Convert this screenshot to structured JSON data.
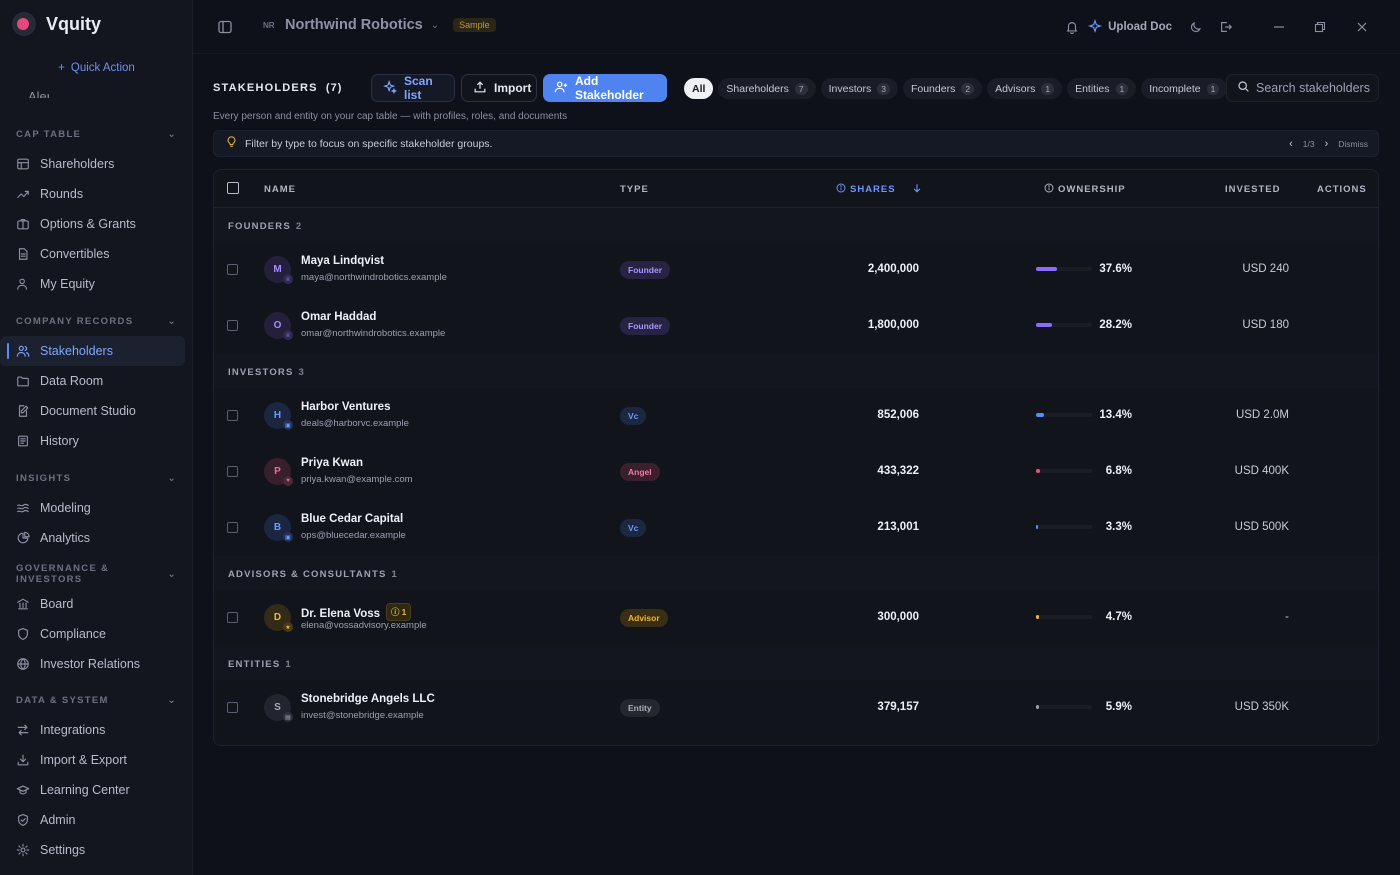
{
  "app": {
    "name": "Vquity",
    "quick_action": "Quick Action",
    "alerts_label": "Alerts"
  },
  "sidebar": {
    "sections": [
      {
        "title": "CAP TABLE",
        "items": [
          {
            "label": "Shareholders",
            "icon": "table-icon"
          },
          {
            "label": "Rounds",
            "icon": "trend-icon"
          },
          {
            "label": "Options & Grants",
            "icon": "briefcase-icon"
          },
          {
            "label": "Convertibles",
            "icon": "document-icon"
          },
          {
            "label": "My Equity",
            "icon": "user-icon"
          }
        ]
      },
      {
        "title": "COMPANY RECORDS",
        "items": [
          {
            "label": "Stakeholders",
            "icon": "users-icon",
            "active": true
          },
          {
            "label": "Data Room",
            "icon": "folder-icon"
          },
          {
            "label": "Document Studio",
            "icon": "edit-document-icon"
          },
          {
            "label": "History",
            "icon": "history-icon"
          }
        ]
      },
      {
        "title": "INSIGHTS",
        "items": [
          {
            "label": "Modeling",
            "icon": "waves-icon"
          },
          {
            "label": "Analytics",
            "icon": "pie-icon"
          }
        ]
      },
      {
        "title": "GOVERNANCE & INVESTORS",
        "items": [
          {
            "label": "Board",
            "icon": "building-icon"
          },
          {
            "label": "Compliance",
            "icon": "shield-icon"
          },
          {
            "label": "Investor Relations",
            "icon": "globe-icon"
          }
        ]
      },
      {
        "title": "DATA & SYSTEM",
        "items": [
          {
            "label": "Integrations",
            "icon": "arrows-icon"
          },
          {
            "label": "Import & Export",
            "icon": "download-icon"
          },
          {
            "label": "Learning Center",
            "icon": "graduation-icon"
          },
          {
            "label": "Admin",
            "icon": "shield-check-icon"
          },
          {
            "label": "Settings",
            "icon": "gear-icon"
          }
        ]
      }
    ]
  },
  "topbar": {
    "org_initials": "NR",
    "org_name": "Northwind Robotics",
    "sample_badge": "Sample",
    "upload_doc": "Upload Doc"
  },
  "page": {
    "title": "STAKEHOLDERS",
    "count": "(7)",
    "scan_list": "Scan list",
    "import": "Import",
    "add_stakeholder": "Add Stakeholder",
    "subtitle": "Every person and entity on your cap table — with profiles, roles, and documents",
    "search_placeholder": "Search stakeholders",
    "tip": "Filter by type to focus on specific stakeholder groups.",
    "tip_page": "1/3",
    "dismiss": "Dismiss"
  },
  "filters": [
    {
      "label": "All",
      "active": true
    },
    {
      "label": "Shareholders",
      "count": "7"
    },
    {
      "label": "Investors",
      "count": "3"
    },
    {
      "label": "Founders",
      "count": "2"
    },
    {
      "label": "Advisors",
      "count": "1"
    },
    {
      "label": "Entities",
      "count": "1"
    },
    {
      "label": "Incomplete",
      "count": "1"
    }
  ],
  "table": {
    "headers": {
      "name": "NAME",
      "type": "TYPE",
      "shares": "SHARES",
      "ownership": "OWNERSHIP",
      "invested": "INVESTED",
      "actions": "ACTIONS"
    },
    "groups": [
      {
        "label": "FOUNDERS",
        "count": "2",
        "rows": [
          {
            "initial": "M",
            "name": "Maya Lindqvist",
            "email": "maya@northwindrobotics.example",
            "type": "Founder",
            "shares": "2,400,000",
            "ownership": "37.6%",
            "ownership_value": 0.376,
            "invested": "USD 240",
            "color": "purple"
          },
          {
            "initial": "O",
            "name": "Omar Haddad",
            "email": "omar@northwindrobotics.example",
            "type": "Founder",
            "shares": "1,800,000",
            "ownership": "28.2%",
            "ownership_value": 0.282,
            "invested": "USD 180",
            "color": "purple"
          }
        ]
      },
      {
        "label": "INVESTORS",
        "count": "3",
        "rows": [
          {
            "initial": "H",
            "name": "Harbor Ventures",
            "email": "deals@harborvc.example",
            "type": "Vc",
            "shares": "852,006",
            "ownership": "13.4%",
            "ownership_value": 0.134,
            "invested": "USD 2.0M",
            "color": "blue"
          },
          {
            "initial": "P",
            "name": "Priya Kwan",
            "email": "priya.kwan@example.com",
            "type": "Angel",
            "shares": "433,322",
            "ownership": "6.8%",
            "ownership_value": 0.068,
            "invested": "USD 400K",
            "color": "pink"
          },
          {
            "initial": "B",
            "name": "Blue Cedar Capital",
            "email": "ops@bluecedar.example",
            "type": "Vc",
            "shares": "213,001",
            "ownership": "3.3%",
            "ownership_value": 0.033,
            "invested": "USD 500K",
            "color": "blue"
          }
        ]
      },
      {
        "label": "ADVISORS & CONSULTANTS",
        "count": "1",
        "rows": [
          {
            "initial": "D",
            "name": "Dr. Elena Voss",
            "email": "elena@vossadvisory.example",
            "type": "Advisor",
            "shares": "300,000",
            "ownership": "4.7%",
            "ownership_value": 0.047,
            "invested": "-",
            "color": "amber",
            "warning": "1"
          }
        ]
      },
      {
        "label": "ENTITIES",
        "count": "1",
        "rows": [
          {
            "initial": "S",
            "name": "Stonebridge Angels LLC",
            "email": "invest@stonebridge.example",
            "type": "Entity",
            "shares": "379,157",
            "ownership": "5.9%",
            "ownership_value": 0.059,
            "invested": "USD 350K",
            "color": "grey"
          }
        ]
      }
    ]
  },
  "colors": {
    "accent": "#4e83f0",
    "purple": "#8b6cff",
    "blue": "#5b8cff",
    "pink": "#f0507f",
    "amber": "#f2b732",
    "grey": "#9aa0b0"
  }
}
